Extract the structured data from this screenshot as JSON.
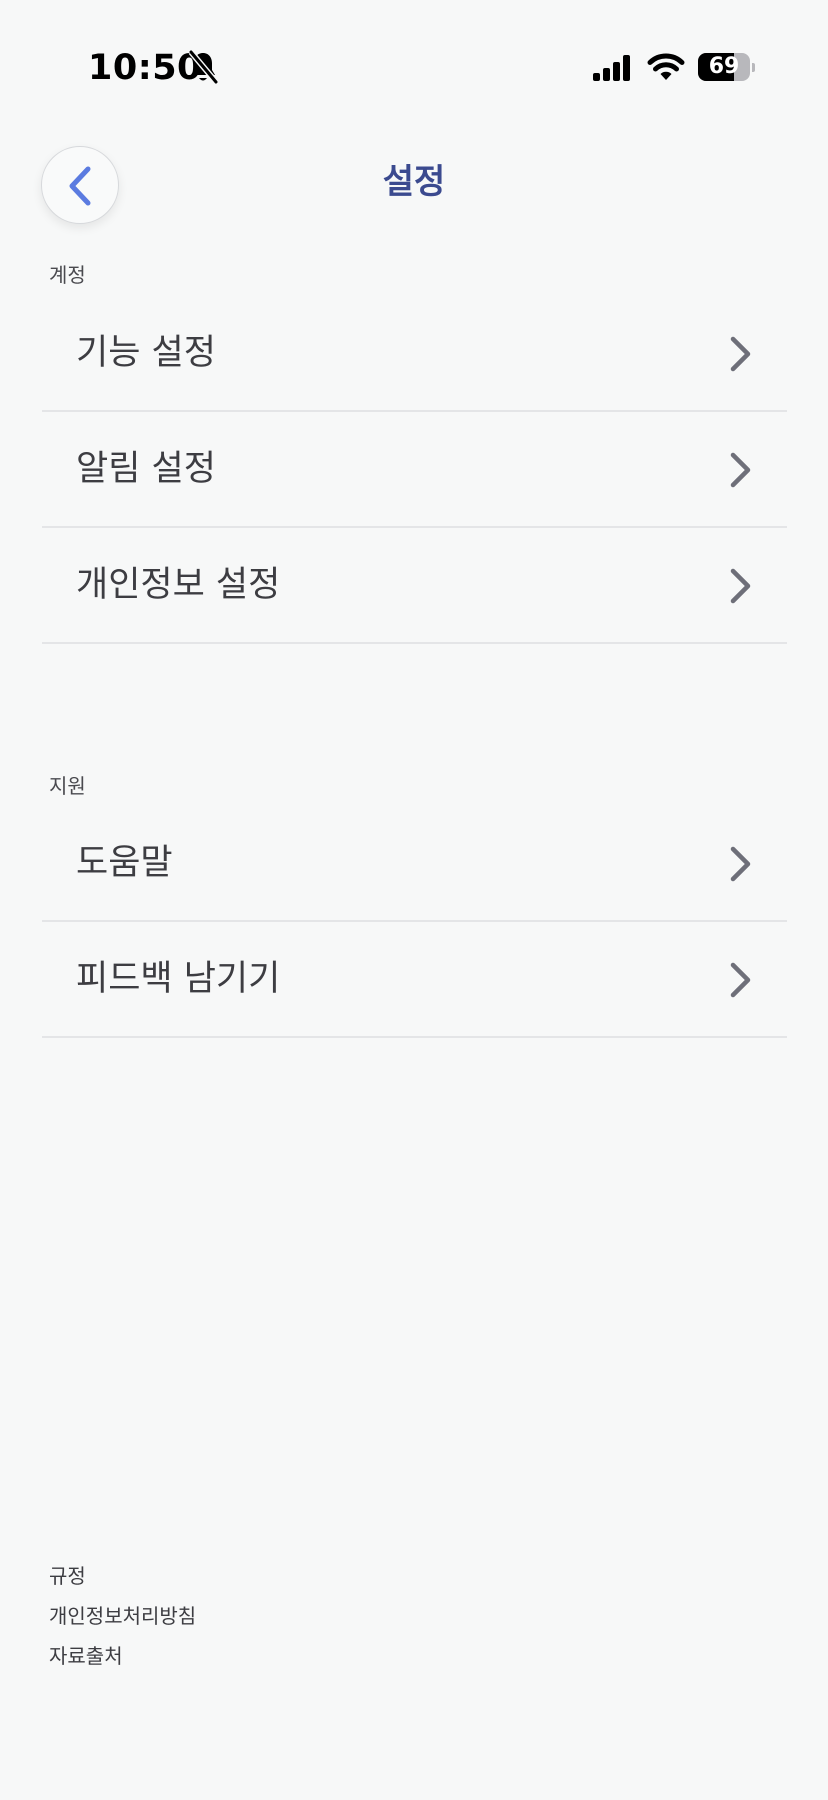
{
  "status_bar": {
    "time": "10:50",
    "battery": "69",
    "battery_level": 0.69
  },
  "header": {
    "title": "설정",
    "back_icon": "chevron-left-icon",
    "accent_color": "#5b7be0",
    "title_color": "#3b4a8f"
  },
  "sections": [
    {
      "label": "계정",
      "items": [
        {
          "label": "기능 설정",
          "icon": "chevron-right-icon"
        },
        {
          "label": "알림 설정",
          "icon": "chevron-right-icon"
        },
        {
          "label": "개인정보 설정",
          "icon": "chevron-right-icon"
        }
      ]
    },
    {
      "label": "지원",
      "items": [
        {
          "label": "도움말",
          "icon": "chevron-right-icon"
        },
        {
          "label": "피드백 남기기",
          "icon": "chevron-right-icon"
        }
      ]
    }
  ],
  "footer": {
    "links": [
      "규정",
      "개인정보처리방침",
      "자료출처"
    ]
  }
}
